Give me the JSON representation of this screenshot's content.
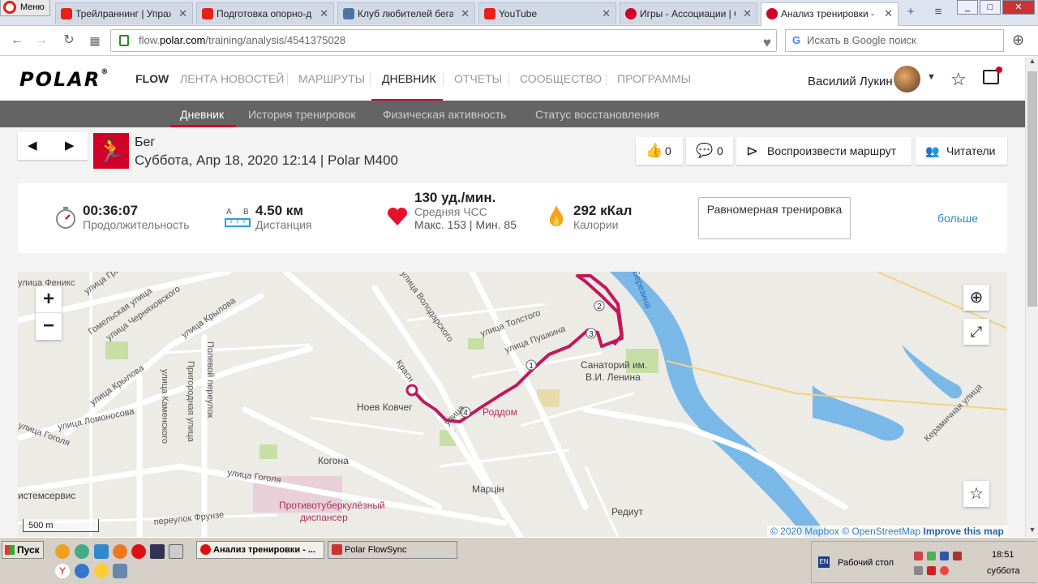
{
  "browser": {
    "menu_label": "Меню",
    "tabs": [
      {
        "title": "Трейлраннинг | Упражнения",
        "favicon_color": "#e62117"
      },
      {
        "title": "Подготовка опорно-двигательного",
        "favicon_color": "#e62117"
      },
      {
        "title": "Клуб любителей бега \"",
        "favicon_color": "#4c75a3"
      },
      {
        "title": "YouTube",
        "favicon_color": "#e62117"
      },
      {
        "title": "Игры - Ассоциации | Стратегии",
        "favicon_color": "#d10027"
      },
      {
        "title": "Анализ тренировки - Polar Flow",
        "favicon_color": "#d10027"
      }
    ],
    "url_prefix": "flow.",
    "url_domain": "polar.com",
    "url_path": "/training/analysis/4541375028",
    "search_placeholder": "Искать в Google поиск"
  },
  "header": {
    "logo": "POLAR",
    "logo_mark": "®",
    "product": "FLOW",
    "nav": [
      "ЛЕНТА НОВОСТЕЙ",
      "МАРШРУТЫ",
      "ДНЕВНИК",
      "ОТЧЕТЫ",
      "СООБЩЕСТВО",
      "ПРОГРАММЫ"
    ],
    "active_nav": "ДНЕВНИК",
    "user_name": "Василий Лукин"
  },
  "subnav": {
    "items": [
      "Дневник",
      "История тренировок",
      "Физическая активность",
      "Статус восстановления"
    ],
    "active": "Дневник"
  },
  "training": {
    "sport": "Бег",
    "date_line": "Суббота, Апр 18, 2020 12:14 | Polar M400",
    "likes": "0",
    "comments": "0",
    "replay_label": "Воспроизвести маршрут",
    "readers_label": "Читатели"
  },
  "summary": {
    "duration_value": "00:36:07",
    "duration_label": "Продолжительность",
    "distance_a": "A",
    "distance_b": "B",
    "distance_value": "4.50 км",
    "distance_label": "Дистанция",
    "hr_value": "130 уд./мин.",
    "hr_label": "Средняя ЧСС",
    "hr_minmax": "Макс. 153 | Мин. 85",
    "calories_value": "292 кКал",
    "calories_label": "Калории",
    "benefit_label": "Равномерная тренировка",
    "more_label": "больше"
  },
  "map": {
    "labels": {
      "phoenix": "улица Феникс",
      "griboedova": "улица Грибо",
      "gomelskaya": "Гомельская улица",
      "chernyakhovskogo": "улица Черняховского",
      "krylova1": "улица Крылова",
      "krylova2": "улица Крылова",
      "lomonosova": "улица Ломоносова",
      "gogolya1": "улица Гоголя",
      "gogolya2": "улица Гоголя",
      "kamenskaya": "улица Каменского",
      "prigorodnaya": "Пригородная улица",
      "polevoy": "Полевой переулок",
      "volodarskogo": "улица Володарского",
      "tolstogo": "улица Толстого",
      "pushkina": "улица Пушкина",
      "krasnaya": "Красн",
      "ulica": "улица",
      "noev": "Ноев Ковчег",
      "roddom": "Роддом",
      "sanatoriy1": "Санаторий им.",
      "sanatoriy2": "В.И. Ленина",
      "kogona": "Когона",
      "martsin": "Марцін",
      "redut": "Редиут",
      "tubercul1": "Противотуберкулёзный",
      "tubercul2": "диспансер",
      "frunze": "переулок Фрунзе",
      "sistemservis": "истемсервис",
      "berezina": "Березина",
      "keramichnaya": "Керамичная улица",
      "scale": "500 m"
    },
    "attribution_year": "© 2020",
    "attribution_mapbox": "Mapbox",
    "attribution_osm": "© OpenStreetMap",
    "attribution_improve": "Improve this map",
    "km_markers": [
      "1",
      "2",
      "3",
      "4"
    ],
    "route_color": "#c2185b"
  },
  "taskbar": {
    "start_label": "Пуск",
    "tasks": [
      "Анализ тренировки - ...",
      "Polar FlowSync"
    ],
    "lang": "EN",
    "desktop_label": "Рабочий стол",
    "time": "18:51",
    "day": "суббота"
  }
}
